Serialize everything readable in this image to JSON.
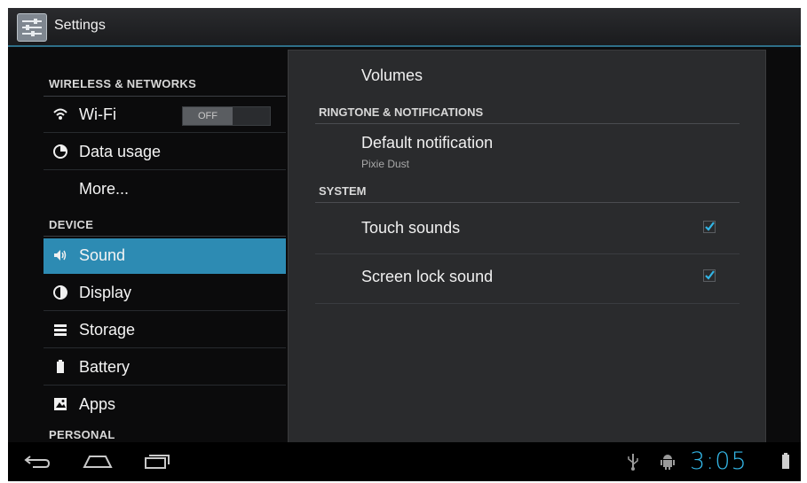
{
  "actionbar": {
    "title": "Settings",
    "icon": "settings-app-icon"
  },
  "left": {
    "categories": {
      "wireless": "WIRELESS & NETWORKS",
      "device": "DEVICE",
      "personal": "PERSONAL"
    },
    "items": {
      "wifi": {
        "label": "Wi-Fi",
        "toggle": "OFF",
        "icon": "wifi-icon"
      },
      "data_usage": {
        "label": "Data usage",
        "icon": "data-usage-icon"
      },
      "more": {
        "label": "More..."
      },
      "sound": {
        "label": "Sound",
        "icon": "speaker-icon",
        "selected": true
      },
      "display": {
        "label": "Display",
        "icon": "display-icon"
      },
      "storage": {
        "label": "Storage",
        "icon": "storage-icon"
      },
      "battery": {
        "label": "Battery",
        "icon": "battery-icon"
      },
      "apps": {
        "label": "Apps",
        "icon": "apps-icon"
      }
    }
  },
  "right": {
    "volumes": "Volumes",
    "ringtone_cat": "RINGTONE & NOTIFICATIONS",
    "default_notification": {
      "title": "Default notification",
      "value": "Pixie Dust"
    },
    "system_cat": "SYSTEM",
    "touch_sounds": {
      "title": "Touch sounds",
      "checked": true
    },
    "screen_lock_sound": {
      "title": "Screen lock sound",
      "checked": true
    }
  },
  "navbar": {
    "time": "3:05",
    "icons": [
      "back-icon",
      "home-icon",
      "recent-apps-icon",
      "usb-icon",
      "android-debug-icon",
      "battery-status-icon"
    ]
  },
  "colors": {
    "accent": "#33b5e5",
    "selected_row": "#2d8bb3",
    "panel": "#2a2b2d",
    "background": "#0b0b0c"
  }
}
